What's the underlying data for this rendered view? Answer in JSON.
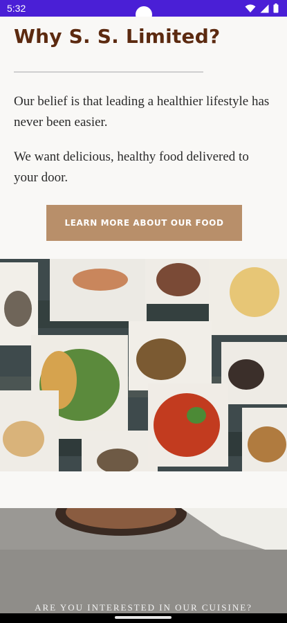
{
  "status_bar": {
    "time": "5:32"
  },
  "section": {
    "title": "Why S. S. Limited?",
    "paragraph1": "Our belief is that leading a healthier lifestyle has never been easier.",
    "paragraph2": "We want delicious, healthy food delivered to your door.",
    "cta_label": "LEARN MORE ABOUT OUR FOOD"
  },
  "bottom_section": {
    "caption": "ARE YOU INTERESTED IN OUR CUISINE?"
  },
  "colors": {
    "status_bar": "#4a1fd6",
    "title": "#5c2a10",
    "button": "#b88f6a",
    "page_bg": "#f9f8f6"
  }
}
